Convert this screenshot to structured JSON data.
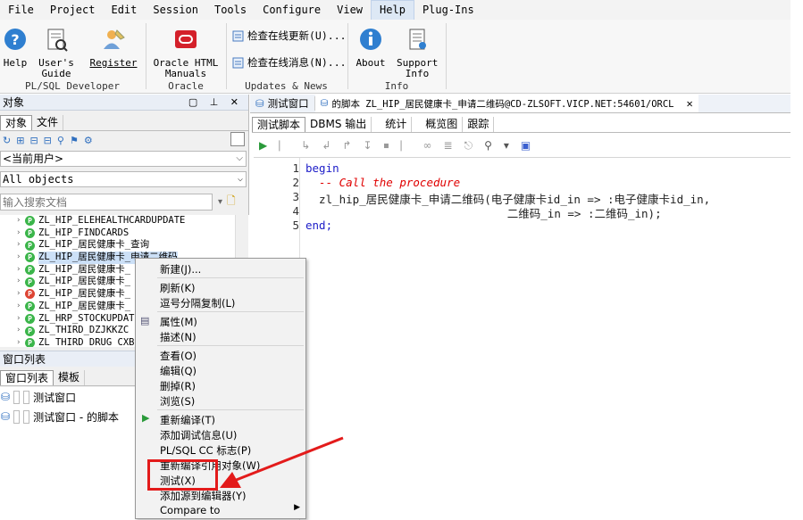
{
  "menubar": {
    "items": [
      "File",
      "Project",
      "Edit",
      "Session",
      "Tools",
      "Configure",
      "View",
      "Help",
      "Plug-Ins"
    ],
    "active": "Help"
  },
  "ribbon": {
    "plsql": {
      "help": "Help",
      "users_guide_1": "User's",
      "users_guide_2": "Guide",
      "register": "Register",
      "group": "PL/SQL Developer"
    },
    "oracle": {
      "html_manuals_1": "Oracle HTML",
      "html_manuals_2": "Manuals",
      "group": "Oracle"
    },
    "updates": {
      "check_updates": "检查在线更新(U)...",
      "check_news": "检查在线消息(N)...",
      "group": "Updates & News"
    },
    "info": {
      "about": "About",
      "support_info_1": "Support",
      "support_info_2": "Info",
      "group": "Info"
    }
  },
  "left": {
    "objects_title": "对象",
    "tabs": [
      "对象",
      "文件"
    ],
    "owner_select": "<当前用户>",
    "filter_select": "All objects",
    "search_placeholder": "输入搜索文档",
    "tree": [
      "ZL_HIP_ELEHEALTHCARDUPDATE",
      "ZL_HIP_FINDCARDS",
      "ZL_HIP_居民健康卡_查询",
      "ZL_HIP_居民健康卡_申请二维码",
      "ZL_HIP_居民健康卡_",
      "ZL_HIP_居民健康卡_",
      "ZL_HIP_居民健康卡_",
      "ZL_HIP_居民健康卡_",
      "ZL_HRP_STOCKUPDATE",
      "ZL_THIRD_DZJKKZC",
      "ZL_THIRD_DRUG_CXB"
    ],
    "window_list_title": "窗口列表",
    "window_tabs": [
      "窗口列表",
      "模板"
    ],
    "windows": [
      "测试窗口",
      "测试窗口 - 的脚本"
    ]
  },
  "context_menu": {
    "items": [
      "新建(J)...",
      "刷新(K)",
      "逗号分隔复制(L)",
      "属性(M)",
      "描述(N)",
      "查看(O)",
      "编辑(Q)",
      "删掉(R)",
      "浏览(S)",
      "重新编译(T)",
      "添加调试信息(U)",
      "PL/SQL CC 标志(P)",
      "重新编译引用对象(W)",
      "测试(X)",
      "添加源到编辑器(Y)",
      "Compare to"
    ]
  },
  "editor": {
    "doc_tabs": [
      "测试窗口",
      "的脚本 ZL_HIP_居民健康卡_申请二维码@CD-ZLSOFT.VICP.NET:54601/ORCL"
    ],
    "sub_tabs": [
      "测试脚本",
      "DBMS 输出",
      "统计",
      "概览图",
      "跟踪"
    ],
    "lines": [
      "begin",
      "  -- Call the procedure",
      "  zl_hip_居民健康卡_申请二维码(电子健康卡id_in => :电子健康卡id_in,",
      "                              二维码_in => :二维码_in);",
      "end;"
    ],
    "line_numbers": [
      "1",
      "2",
      "3",
      "4",
      "5"
    ]
  },
  "colors": {
    "keyword": "#1c1cc8",
    "comment": "#e00000",
    "highlight_box": "#e31b1b",
    "accent": "#dde8f5"
  }
}
